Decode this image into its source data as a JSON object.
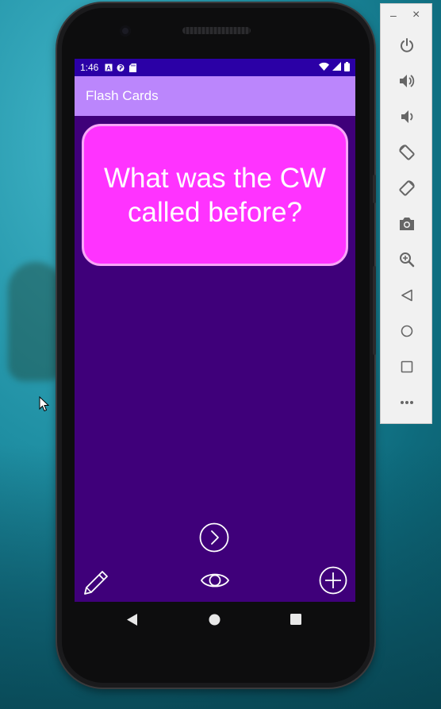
{
  "status_bar": {
    "time": "1:46",
    "icons": [
      "notification-a-icon",
      "notification-p-icon",
      "sd-card-icon",
      "wifi-icon",
      "signal-icon",
      "battery-icon"
    ]
  },
  "app_bar": {
    "title": "Flash Cards",
    "color": "#bb86fc"
  },
  "card": {
    "text": "What was the CW called before?",
    "color": "#ff33ff"
  },
  "controls": {
    "next": "chevron-right-circle-icon",
    "edit": "pencil-icon",
    "reveal": "eye-icon",
    "add": "plus-circle-icon"
  },
  "nav_bar": {
    "back": "back-triangle-icon",
    "home": "home-circle-icon",
    "recents": "recents-square-icon"
  },
  "emulator_toolbar": {
    "minimize_label": "–",
    "close_label": "×",
    "buttons": [
      "power-icon",
      "volume-up-icon",
      "volume-down-icon",
      "rotate-left-icon",
      "rotate-right-icon",
      "camera-icon",
      "zoom-icon",
      "back-icon",
      "home-icon",
      "overview-icon",
      "more-icon"
    ]
  },
  "colors": {
    "screen_background": "#3f007a",
    "status_bar": "#2b00a6"
  }
}
